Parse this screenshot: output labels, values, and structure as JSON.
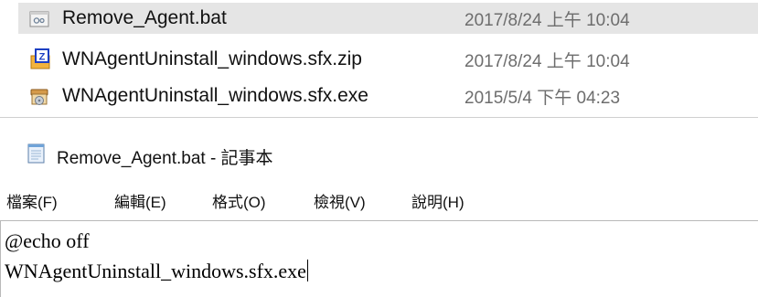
{
  "explorer": {
    "files": [
      {
        "name": "Remove_Agent.bat",
        "modified": "2017/8/24 上午 10:04",
        "icon": "batch-file-icon",
        "selected": true
      },
      {
        "name": "WNAgentUninstall_windows.sfx.zip",
        "modified": "2017/8/24 上午 10:04",
        "icon": "zip-archive-icon",
        "selected": false
      },
      {
        "name": "WNAgentUninstall_windows.sfx.exe",
        "modified": "2015/5/4 下午 04:23",
        "icon": "sfx-installer-icon",
        "selected": false
      }
    ],
    "selected_row_color": "#e5e5e5"
  },
  "notepad": {
    "title": "Remove_Agent.bat - 記事本",
    "icon": "notepad-icon",
    "menu": {
      "file": "檔案(F)",
      "edit": "編輯(E)",
      "format": "格式(O)",
      "view": "檢視(V)",
      "help": "說明(H)"
    },
    "content": {
      "line1": "@echo off",
      "line2": "WNAgentUninstall_windows.sfx.exe"
    }
  }
}
